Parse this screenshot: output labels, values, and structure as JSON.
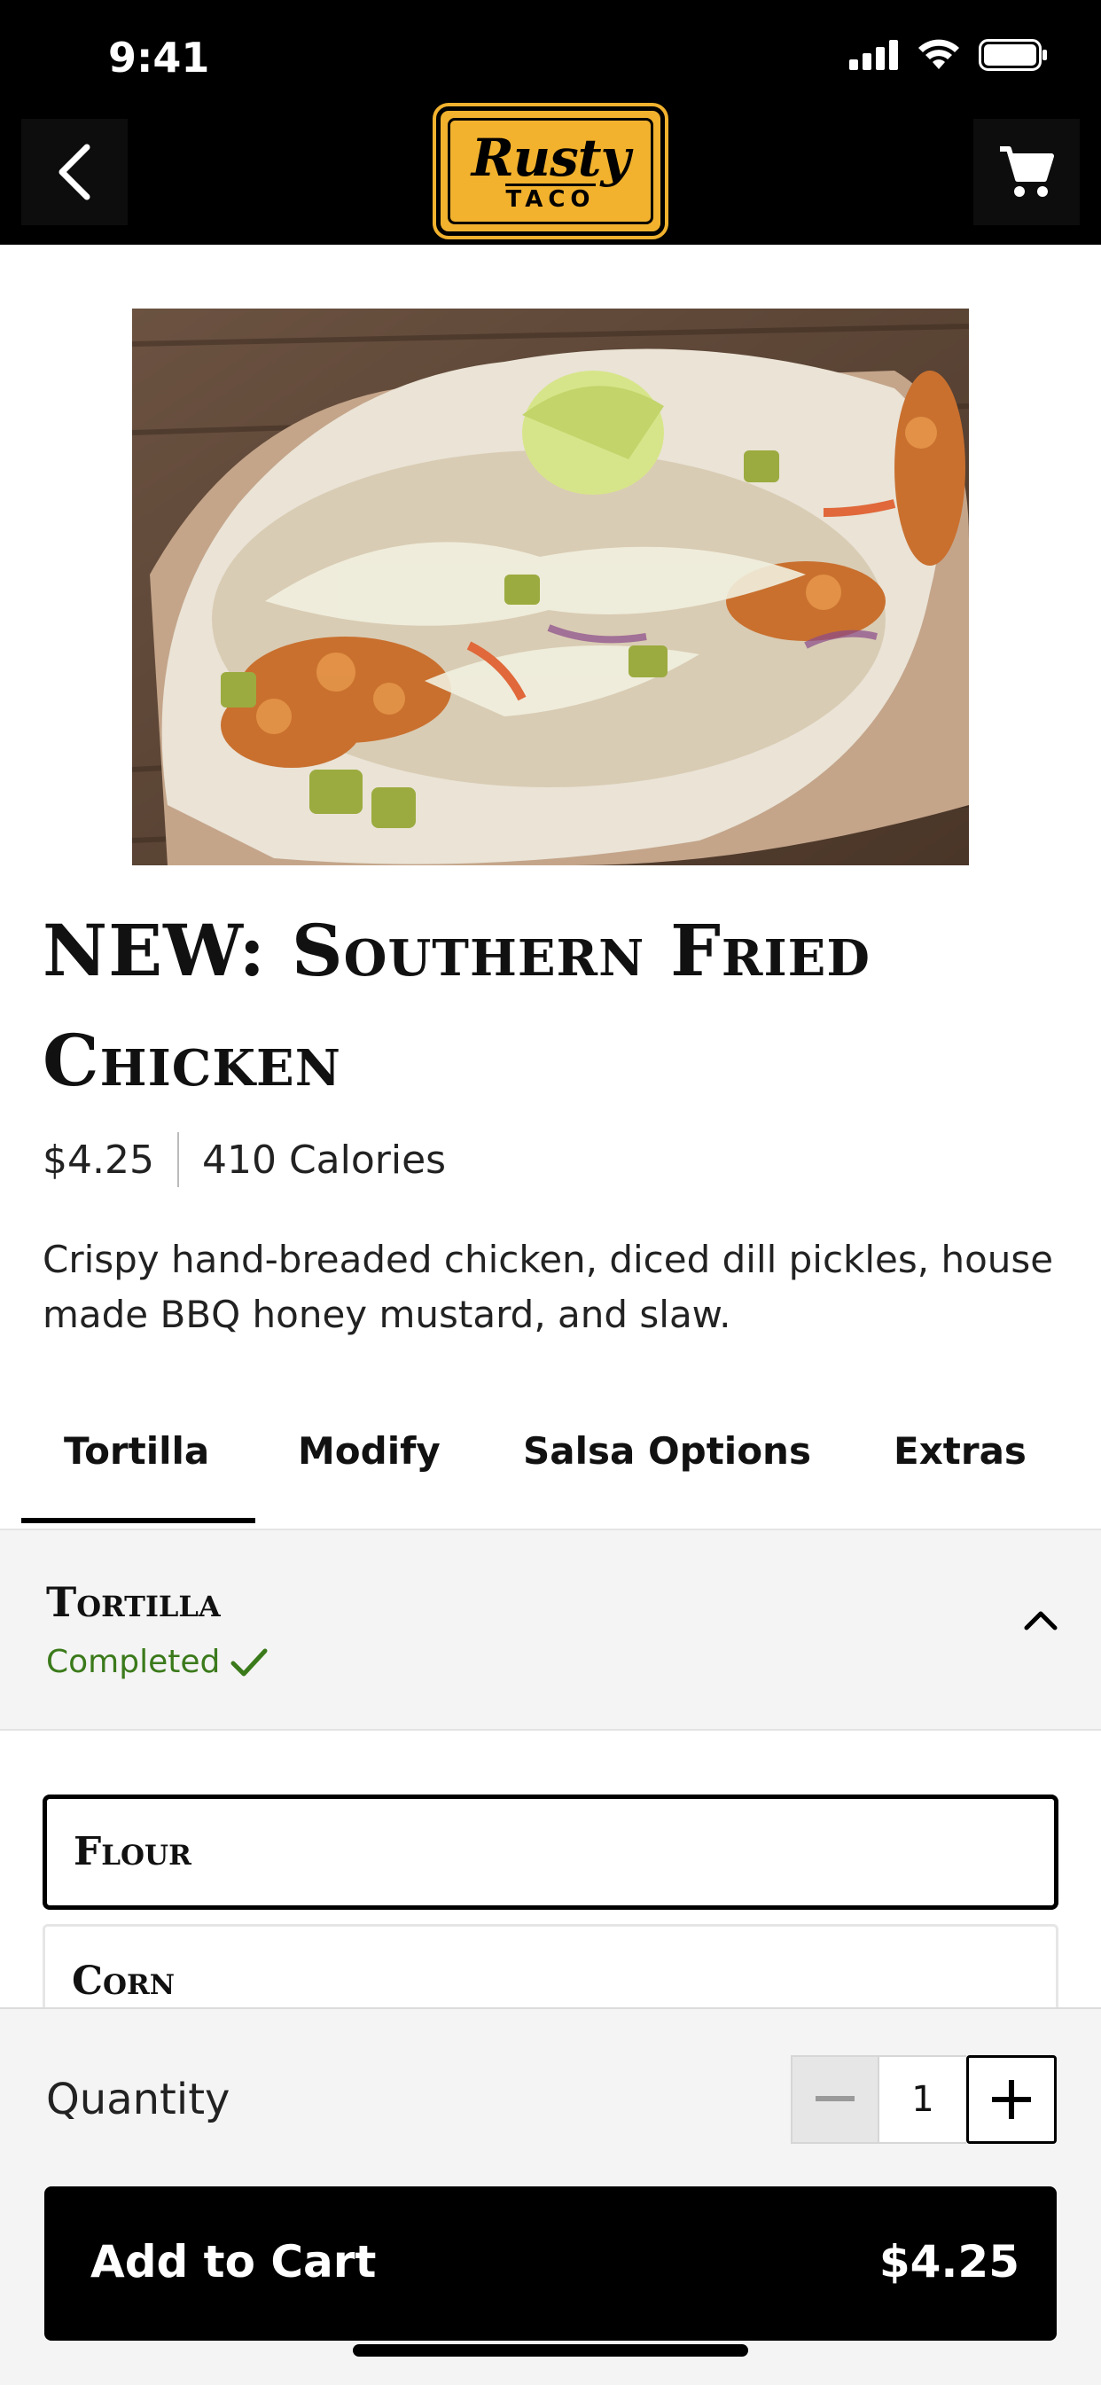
{
  "status_bar": {
    "time": "9:41",
    "icons": [
      "signal-icon",
      "wifi-icon",
      "battery-icon"
    ]
  },
  "header": {
    "logo_top": "Rusty",
    "logo_bottom": "TACO",
    "back_icon": "back-arrow-icon",
    "cart_icon": "cart-icon"
  },
  "product": {
    "title": "NEW: Southern Fried Chicken",
    "price": "$4.25",
    "calories": "410 Calories",
    "description": "Crispy hand-breaded chicken, diced dill pickles, house made BBQ honey mustard, and slaw."
  },
  "tabs": [
    {
      "label": "Tortilla",
      "active": true
    },
    {
      "label": "Modify"
    },
    {
      "label": "Salsa Options"
    },
    {
      "label": "Extras"
    }
  ],
  "section": {
    "title": "Tortilla",
    "status": "Completed",
    "status_color": "#3b7a1b"
  },
  "options": [
    {
      "label": "Flour",
      "selected": true
    },
    {
      "label": "Corn",
      "selected": false
    }
  ],
  "footer": {
    "quantity_label": "Quantity",
    "quantity_value": "1",
    "add_to_cart_label": "Add to Cart",
    "total": "$4.25"
  },
  "colors": {
    "brand": "#f2b22e",
    "primary": "#000000",
    "success": "#3b7a1b"
  }
}
